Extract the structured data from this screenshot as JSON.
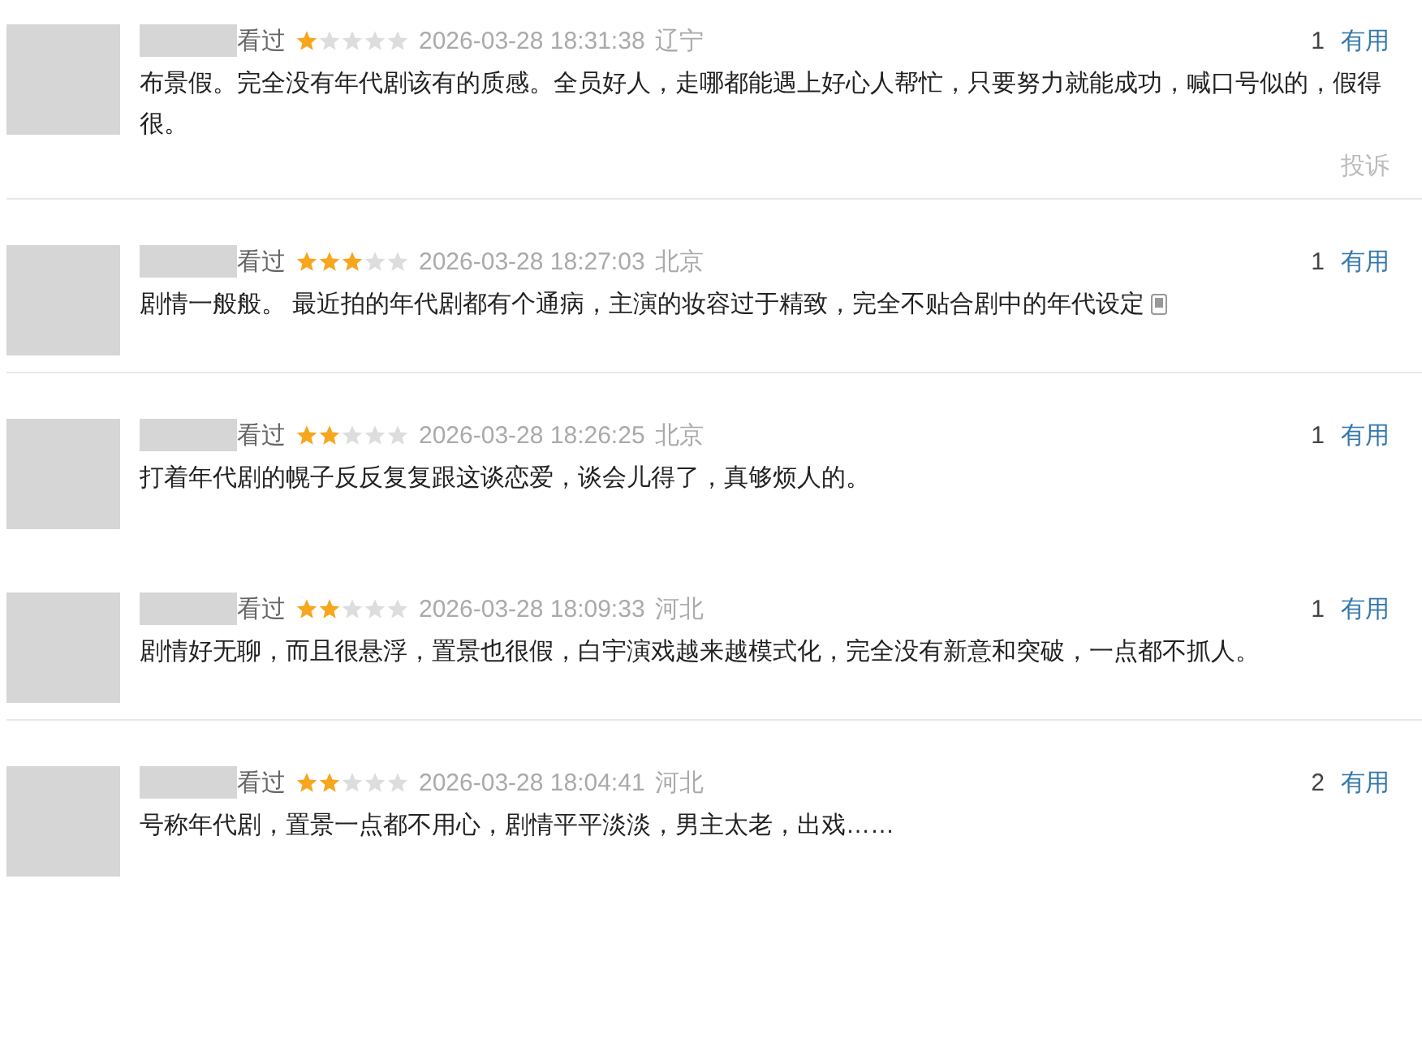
{
  "reviews": [
    {
      "status": "看过",
      "stars": 1,
      "time": "2026-03-28 18:31:38",
      "location": "辽宁",
      "votes": "1",
      "vote_label": "有用",
      "text": "布景假。完全没有年代剧该有的质感。全员好人，走哪都能遇上好心人帮忙，只要努力就能成功，喊口号似的，假得很。",
      "report": "投诉",
      "mobile": false,
      "divider": true
    },
    {
      "status": "看过",
      "stars": 3,
      "time": "2026-03-28 18:27:03",
      "location": "北京",
      "votes": "1",
      "vote_label": "有用",
      "text": "剧情一般般。 最近拍的年代剧都有个通病，主演的妆容过于精致，完全不贴合剧中的年代设定",
      "mobile": true,
      "divider": true
    },
    {
      "status": "看过",
      "stars": 2,
      "time": "2026-03-28 18:26:25",
      "location": "北京",
      "votes": "1",
      "vote_label": "有用",
      "text": "打着年代剧的幌子反反复复跟这谈恋爱，谈会儿得了，真够烦人的。",
      "mobile": false,
      "divider": false
    },
    {
      "status": "看过",
      "stars": 2,
      "time": "2026-03-28 18:09:33",
      "location": "河北",
      "votes": "1",
      "vote_label": "有用",
      "text": "剧情好无聊，而且很悬浮，置景也很假，白宇演戏越来越模式化，完全没有新意和突破，一点都不抓人。",
      "mobile": false,
      "divider": true
    },
    {
      "status": "看过",
      "stars": 2,
      "time": "2026-03-28 18:04:41",
      "location": "河北",
      "votes": "2",
      "vote_label": "有用",
      "text": "号称年代剧，置景一点都不用心，剧情平平淡淡，男主太老，出戏……",
      "mobile": false,
      "divider": false
    }
  ]
}
